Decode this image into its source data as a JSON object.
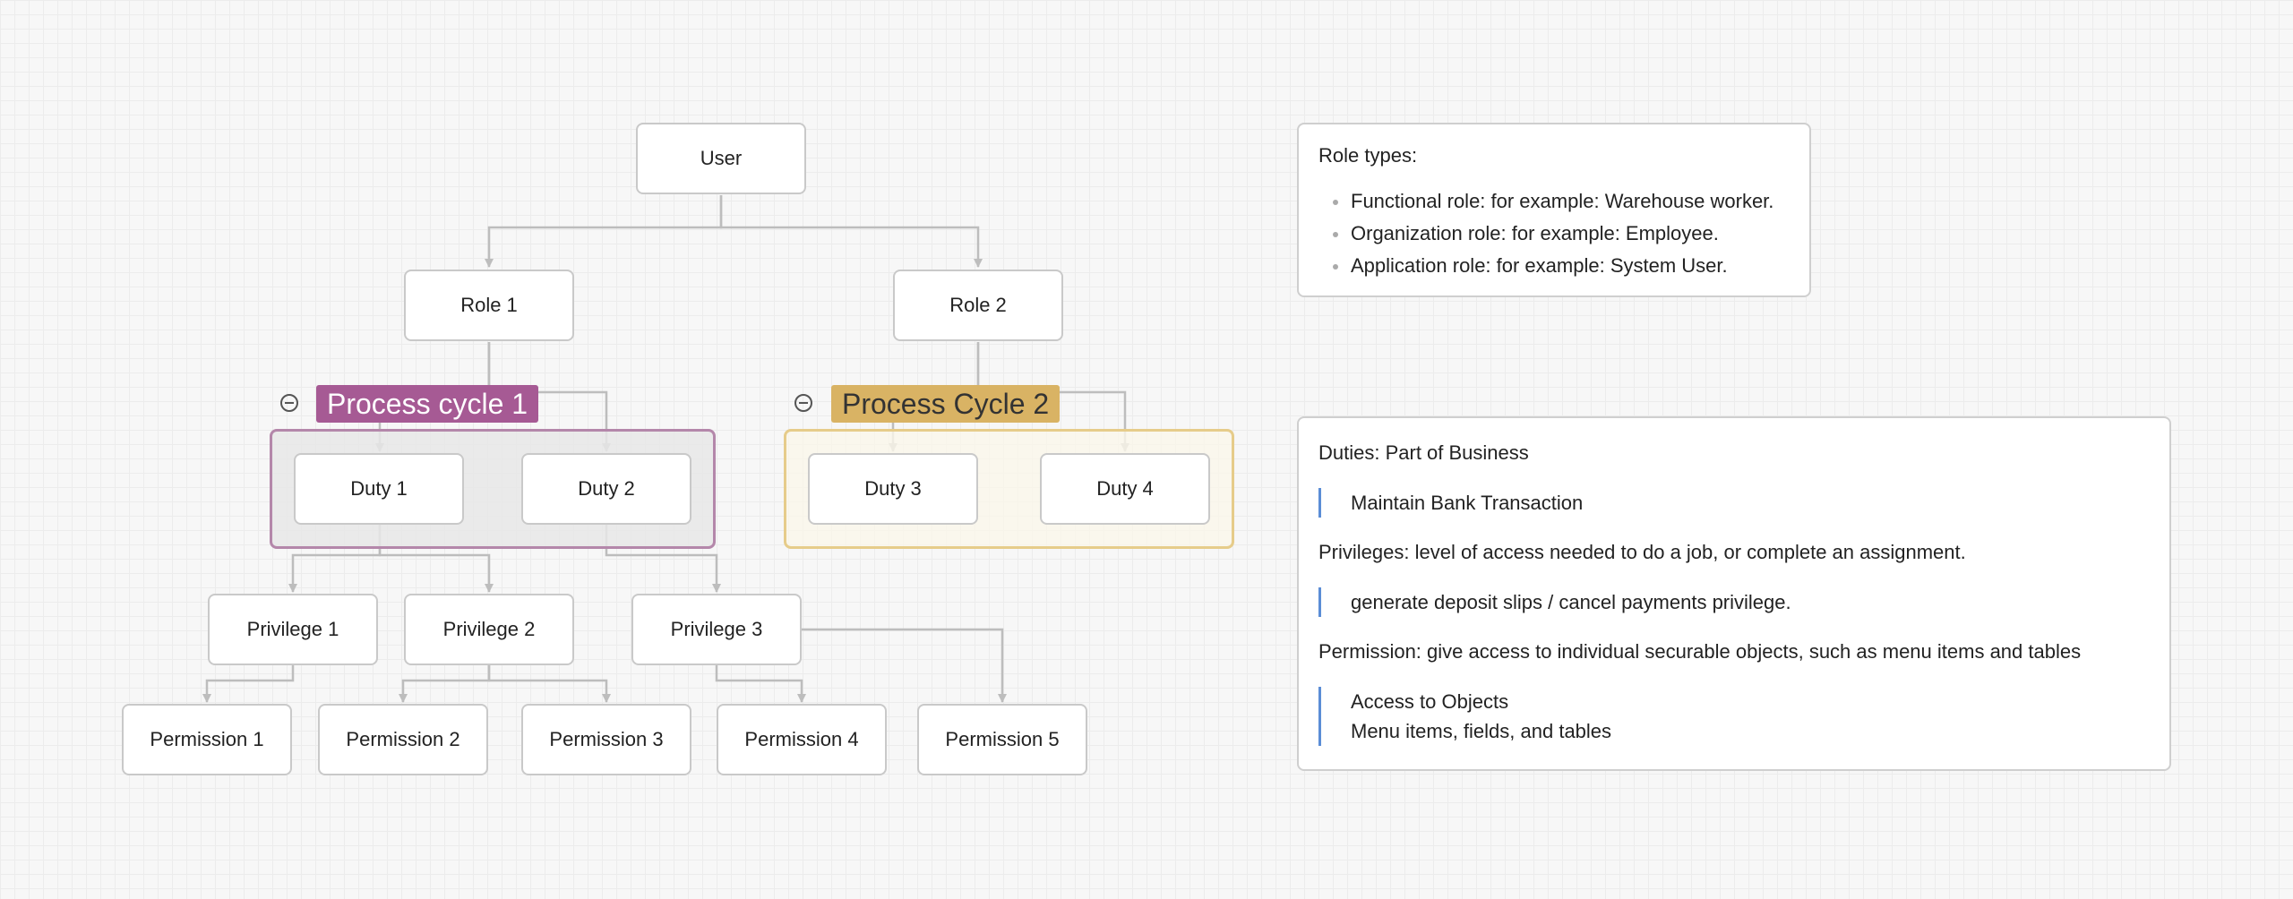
{
  "diagram": {
    "nodes": {
      "user": "User",
      "role1": "Role 1",
      "role2": "Role 2",
      "duty1": "Duty 1",
      "duty2": "Duty 2",
      "duty3": "Duty 3",
      "duty4": "Duty 4",
      "privilege1": "Privilege 1",
      "privilege2": "Privilege 2",
      "privilege3": "Privilege 3",
      "permission1": "Permission 1",
      "permission2": "Permission 2",
      "permission3": "Permission 3",
      "permission4": "Permission 4",
      "permission5": "Permission 5"
    },
    "groups": {
      "process_cycle_1": "Process cycle 1",
      "process_cycle_2": "Process Cycle 2"
    },
    "group_colors": {
      "process_cycle_1": "#a65a94",
      "process_cycle_2": "#d9b364"
    },
    "connector_color": "#bdbdbd"
  },
  "notes": {
    "role_types": {
      "heading": "Role types:",
      "items": [
        "Functional role: for example: Warehouse worker.",
        "Organization role: for example: Employee.",
        "Application role: for example: System User."
      ]
    },
    "definitions": {
      "duties_heading": "Duties: Part of Business",
      "duties_quote": "Maintain Bank Transaction",
      "privileges_heading": "Privileges: level of access needed to do a job, or complete an assignment.",
      "privileges_quote": "generate deposit slips / cancel payments privilege.",
      "permission_heading": "Permission: give access to individual securable objects, such as menu items and tables",
      "permission_quote_line1": "Access to Objects",
      "permission_quote_line2": "Menu items, fields, and tables",
      "quote_bar_color": "#5b8dd6"
    }
  }
}
